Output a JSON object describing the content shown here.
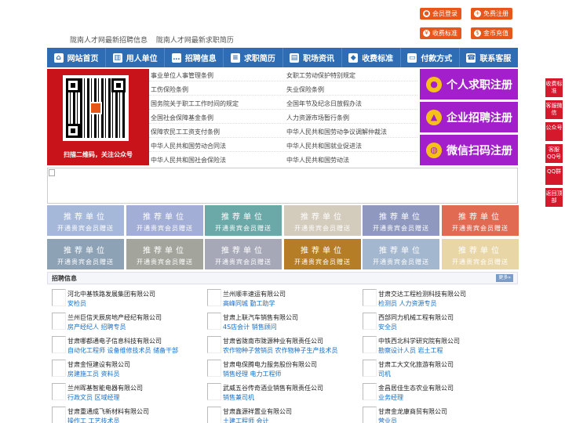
{
  "header": {
    "links": [
      "陇南人才网最新招聘信息",
      "陇南人才网最新求职简历"
    ],
    "buttons": [
      {
        "label": "会员登录",
        "icon": "user-icon"
      },
      {
        "label": "免费注册",
        "icon": "user-add-icon"
      },
      {
        "label": "收费标准",
        "icon": "money-icon"
      },
      {
        "label": "金币充值",
        "icon": "coin-icon"
      }
    ]
  },
  "nav": [
    {
      "label": "网站首页",
      "icon": "home-icon"
    },
    {
      "label": "用人单位",
      "icon": "building-icon"
    },
    {
      "label": "招聘信息",
      "icon": "chat-icon"
    },
    {
      "label": "求职简历",
      "icon": "resume-icon"
    },
    {
      "label": "职场资讯",
      "icon": "news-icon"
    },
    {
      "label": "收费标准",
      "icon": "tag-icon"
    },
    {
      "label": "付款方式",
      "icon": "card-icon"
    },
    {
      "label": "联系客服",
      "icon": "phone-icon"
    }
  ],
  "qr": {
    "caption": "扫描二维码，关注公众号"
  },
  "articles": [
    [
      "事业单位人事管理条例",
      "女职工劳动保护特别规定"
    ],
    [
      "工伤保险条例",
      "失业保险条例"
    ],
    [
      "国务院关于职工工作时间的规定",
      "全国年节及纪念日放假办法"
    ],
    [
      "全国社会保障基金条例",
      "人力资源市场暂行条例"
    ],
    [
      "保障农民工工资支付条例",
      "中华人民共和国劳动争议调解仲裁法"
    ],
    [
      "中华人民共和国劳动合同法",
      "中华人民共和国就业促进法"
    ],
    [
      "中华人民共和国社会保险法",
      "中华人民共和国劳动法"
    ]
  ],
  "register": [
    {
      "label": "个人求职注册",
      "icon": "person-icon"
    },
    {
      "label": "企业招聘注册",
      "icon": "company-icon"
    },
    {
      "label": "微信扫码注册",
      "icon": "wechat-icon"
    }
  ],
  "tiles": {
    "title": "推荐单位",
    "subtitle": "开通贵宾会员赠送",
    "colors": [
      "#a5b8da",
      "#a3aed6",
      "#6aa9a8",
      "#d3cbbc",
      "#8f99c0",
      "#e06b52",
      "#8ea2b5",
      "#a3a49b",
      "#a6a8b8",
      "#b57d25",
      "#a3b7ce",
      "#e8d6a6"
    ]
  },
  "jobs": {
    "title": "招聘信息",
    "more": "更多»",
    "items": [
      {
        "company": "河北中基铁路发展集团有限公司",
        "positions": "安检员"
      },
      {
        "company": "兰州顺丰速运有限公司",
        "positions": "高峰同城 勤工助学"
      },
      {
        "company": "甘肃交达工程检测科技有限公司",
        "positions": "检测员 人力资源专员"
      },
      {
        "company": "兰州巨信天辰房地产经纪有限公司",
        "positions": "房产经纪人 招聘专员"
      },
      {
        "company": "甘肃上联汽车销售有限公司",
        "positions": "4S店会计 销售顾问"
      },
      {
        "company": "西部同力机械工程有限公司",
        "positions": "安全员"
      },
      {
        "company": "甘肃哪都通电子信息科技有限公司",
        "positions": "自动化工程师 设备维修技术员 储备干部"
      },
      {
        "company": "甘肃省陇南市陇源种业有限责任公司",
        "positions": "农作物种子营销员 农作物种子生产技术员"
      },
      {
        "company": "中铁西北科学研究院有限公司",
        "positions": "勘察设计人员 岩土工程"
      },
      {
        "company": "甘肃金恒建设有限公司",
        "positions": "房建施工员 资料员"
      },
      {
        "company": "甘肃电保腾电力服务股份有限公司",
        "positions": "销售经理 电力工程师"
      },
      {
        "company": "甘肃工大文化旅游有限公司",
        "positions": "司机"
      },
      {
        "company": "兰州晖基智能电器有限公司",
        "positions": "行政文员 区域经理"
      },
      {
        "company": "武威五谷传奇酒业销售有限责任公司",
        "positions": "销售兼司机"
      },
      {
        "company": "金昌居佳生态农业有限公司",
        "positions": "业务经理"
      },
      {
        "company": "甘肃重通成飞新材料有限公司",
        "positions": "操作工 工艺技术员"
      },
      {
        "company": "甘肃鑫源祥置业有限公司",
        "positions": "土建工程师 会计"
      },
      {
        "company": "甘肃金龙康商贸有限公司",
        "positions": "营业员"
      }
    ]
  },
  "float": [
    "收费标准",
    "客服微信",
    "公众号",
    "客服QQ号",
    "QQ群",
    "返回顶部"
  ]
}
